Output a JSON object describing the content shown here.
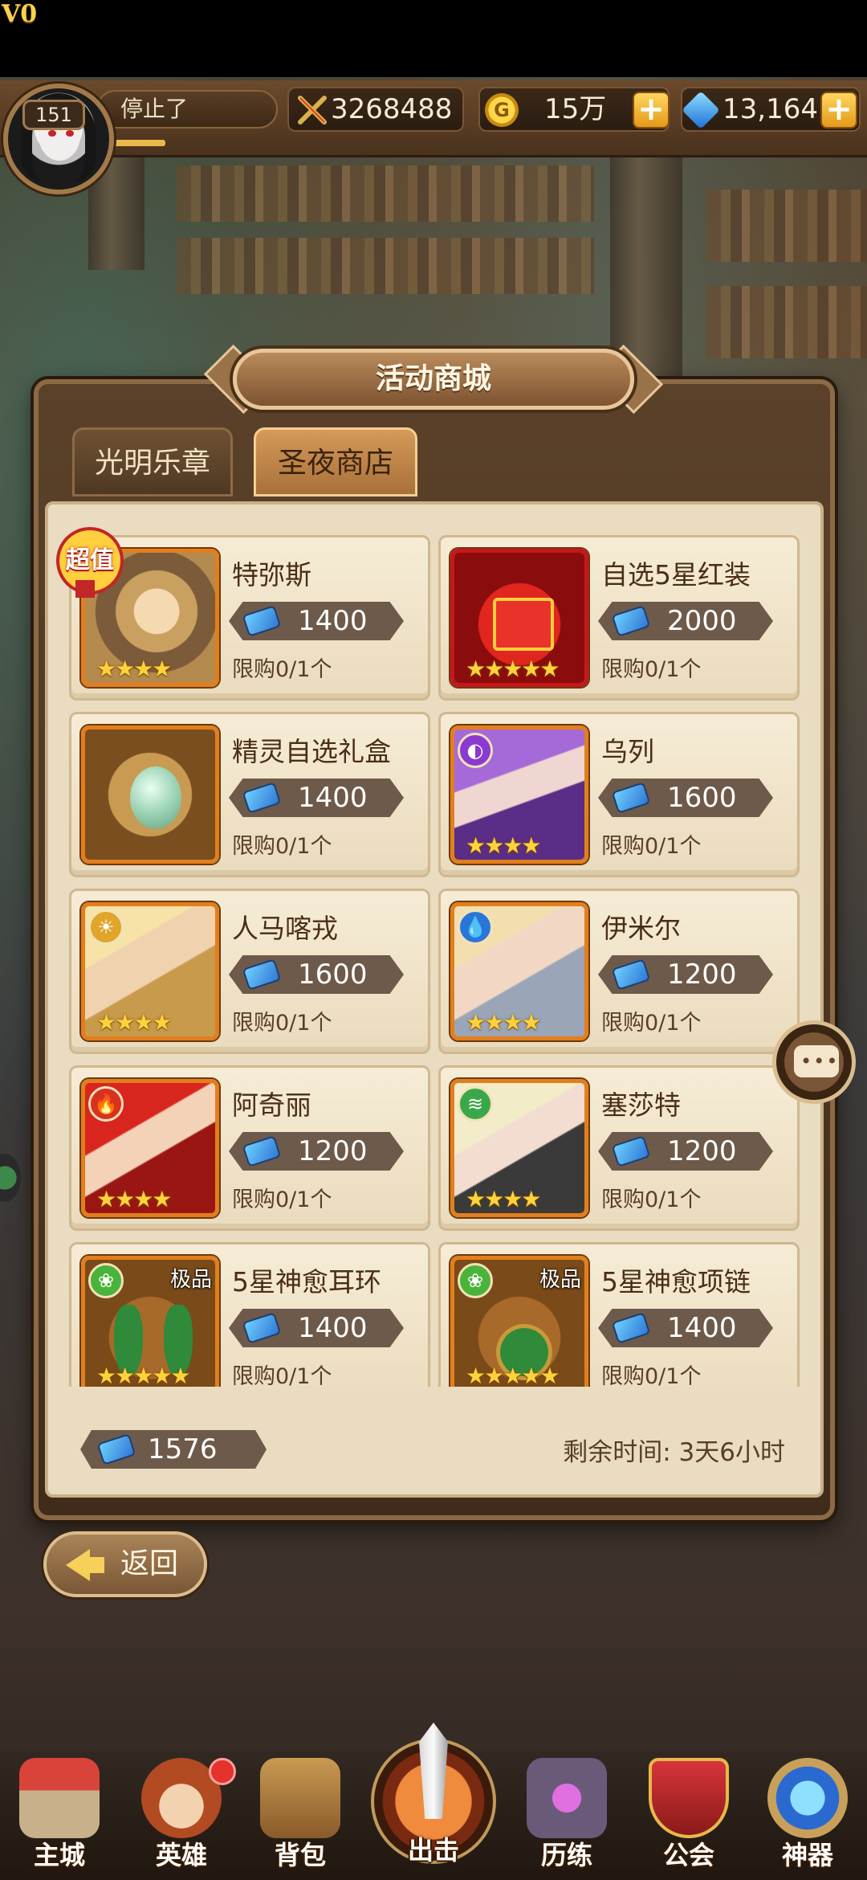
{
  "player": {
    "vip": "V0",
    "level": "151",
    "name": "停止了",
    "power": "3268488",
    "gold": "15万",
    "gems": "13,164"
  },
  "dialog": {
    "title": "活动商城",
    "tabs": [
      {
        "label": "光明乐章",
        "active": false
      },
      {
        "label": "圣夜商店",
        "active": true
      }
    ]
  },
  "items": [
    {
      "name": "特弥斯",
      "price": "1400",
      "limit": "限购0/1个",
      "stars": "★★★★",
      "badge": "超值"
    },
    {
      "name": "自选5星红装",
      "price": "2000",
      "limit": "限购0/1个",
      "stars": "★★★★★"
    },
    {
      "name": "精灵自选礼盒",
      "price": "1400",
      "limit": "限购0/1个",
      "stars": ""
    },
    {
      "name": "乌列",
      "price": "1600",
      "limit": "限购0/1个",
      "stars": "★★★★",
      "element": "dark"
    },
    {
      "name": "人马喀戎",
      "price": "1600",
      "limit": "限购0/1个",
      "stars": "★★★★",
      "element": "light"
    },
    {
      "name": "伊米尔",
      "price": "1200",
      "limit": "限购0/1个",
      "stars": "★★★★",
      "element": "water"
    },
    {
      "name": "阿奇丽",
      "price": "1200",
      "limit": "限购0/1个",
      "stars": "★★★★",
      "element": "fire"
    },
    {
      "name": "塞莎特",
      "price": "1200",
      "limit": "限购0/1个",
      "stars": "★★★★",
      "element": "wind"
    },
    {
      "name": "5星神愈耳环",
      "price": "1400",
      "limit": "限购0/1个",
      "stars": "★★★★★",
      "tag": "极品",
      "element": "nature"
    },
    {
      "name": "5星神愈项链",
      "price": "1400",
      "limit": "限购0/1个",
      "stars": "★★★★★",
      "tag": "极品",
      "element": "nature"
    }
  ],
  "footer": {
    "currency": "1576",
    "remaining": "剩余时间: 3天6小时"
  },
  "back_label": "返回",
  "nav": [
    {
      "label": "主城",
      "icon": "castle-icon"
    },
    {
      "label": "英雄",
      "icon": "hero-icon"
    },
    {
      "label": "背包",
      "icon": "backpack-icon"
    },
    {
      "label": "出击",
      "icon": "sword-icon"
    },
    {
      "label": "历练",
      "icon": "trial-icon"
    },
    {
      "label": "公会",
      "icon": "guild-shield-icon"
    },
    {
      "label": "神器",
      "icon": "artifact-crystal-icon"
    }
  ],
  "colors": {
    "accent_orange": "#e37e1c",
    "panel_brown": "#5b4129",
    "card_cream": "#f6ecd6",
    "price_pill": "#6e5a4a"
  }
}
